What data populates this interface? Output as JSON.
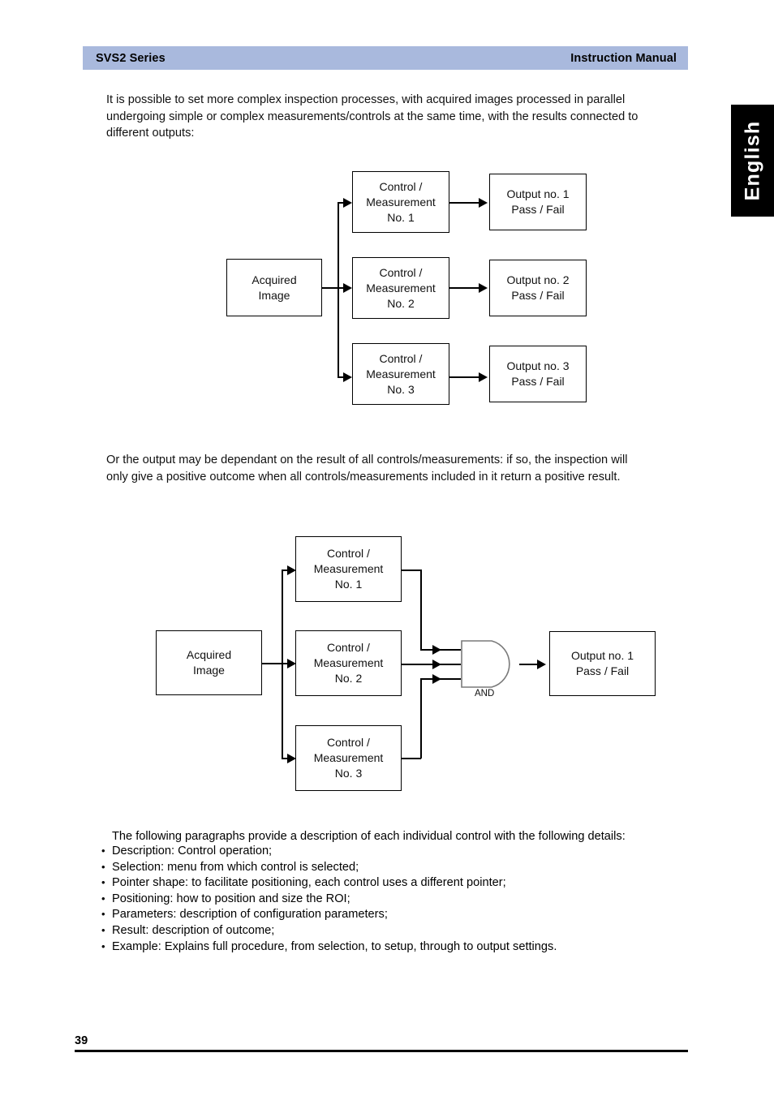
{
  "header": {
    "left_title": "SVS2 Series",
    "right_title": "Instruction Manual",
    "bar_color": "#a9b9dd"
  },
  "language_tab": {
    "label": "English",
    "background": "#000000",
    "text_color": "#ffffff"
  },
  "paragraph_1": {
    "line_1": "It is possible to set more complex inspection processes, with acquired images processed in parallel",
    "line_2": "undergoing simple or complex measurements/controls at the same time, with the results connected to",
    "line_3": "different outputs:"
  },
  "paragraph_2": {
    "line_1": "Or the output may be dependant on the result of all controls/measurements: if so, the inspection will",
    "line_2": "only give a positive outcome when all controls/measurements included in it return a positive result."
  },
  "diagram_1": {
    "source": {
      "line_1": "Acquired",
      "line_2": "Image"
    },
    "controls": [
      {
        "line_1": "Control /",
        "line_2": "Measurement",
        "line_3": "No. 1"
      },
      {
        "line_1": "Control /",
        "line_2": "Measurement",
        "line_3": "No. 2"
      },
      {
        "line_1": "Control /",
        "line_2": "Measurement",
        "line_3": "No. 3"
      }
    ],
    "outputs": [
      {
        "line_1": "Output no. 1",
        "line_2": "Pass / Fail"
      },
      {
        "line_1": "Output no. 2",
        "line_2": "Pass / Fail"
      },
      {
        "line_1": "Output no. 3",
        "line_2": "Pass / Fail"
      }
    ]
  },
  "diagram_2": {
    "source": {
      "line_1": "Acquired",
      "line_2": "Image"
    },
    "controls": [
      {
        "line_1": "Control /",
        "line_2": "Measurement",
        "line_3": "No. 1"
      },
      {
        "line_1": "Control /",
        "line_2": "Measurement",
        "line_3": "No. 2"
      },
      {
        "line_1": "Control /",
        "line_2": "Measurement",
        "line_3": "No. 3"
      }
    ],
    "gate": {
      "label": "AND"
    },
    "output": {
      "line_1": "Output no. 1",
      "line_2": "Pass / Fail"
    }
  },
  "details_intro": "The following paragraphs provide a description of each individual control with the following details:",
  "details_bullets": [
    "Description: Control operation;",
    "Selection: menu from which control is selected;",
    "Pointer shape: to facilitate positioning, each control uses a different pointer;",
    "Positioning: how to position and size the ROI;",
    "Parameters: description of configuration parameters;",
    "Result: description of outcome;",
    "Example: Explains full procedure, from selection, to setup, through to output settings."
  ],
  "footer": {
    "page_number": "39"
  }
}
